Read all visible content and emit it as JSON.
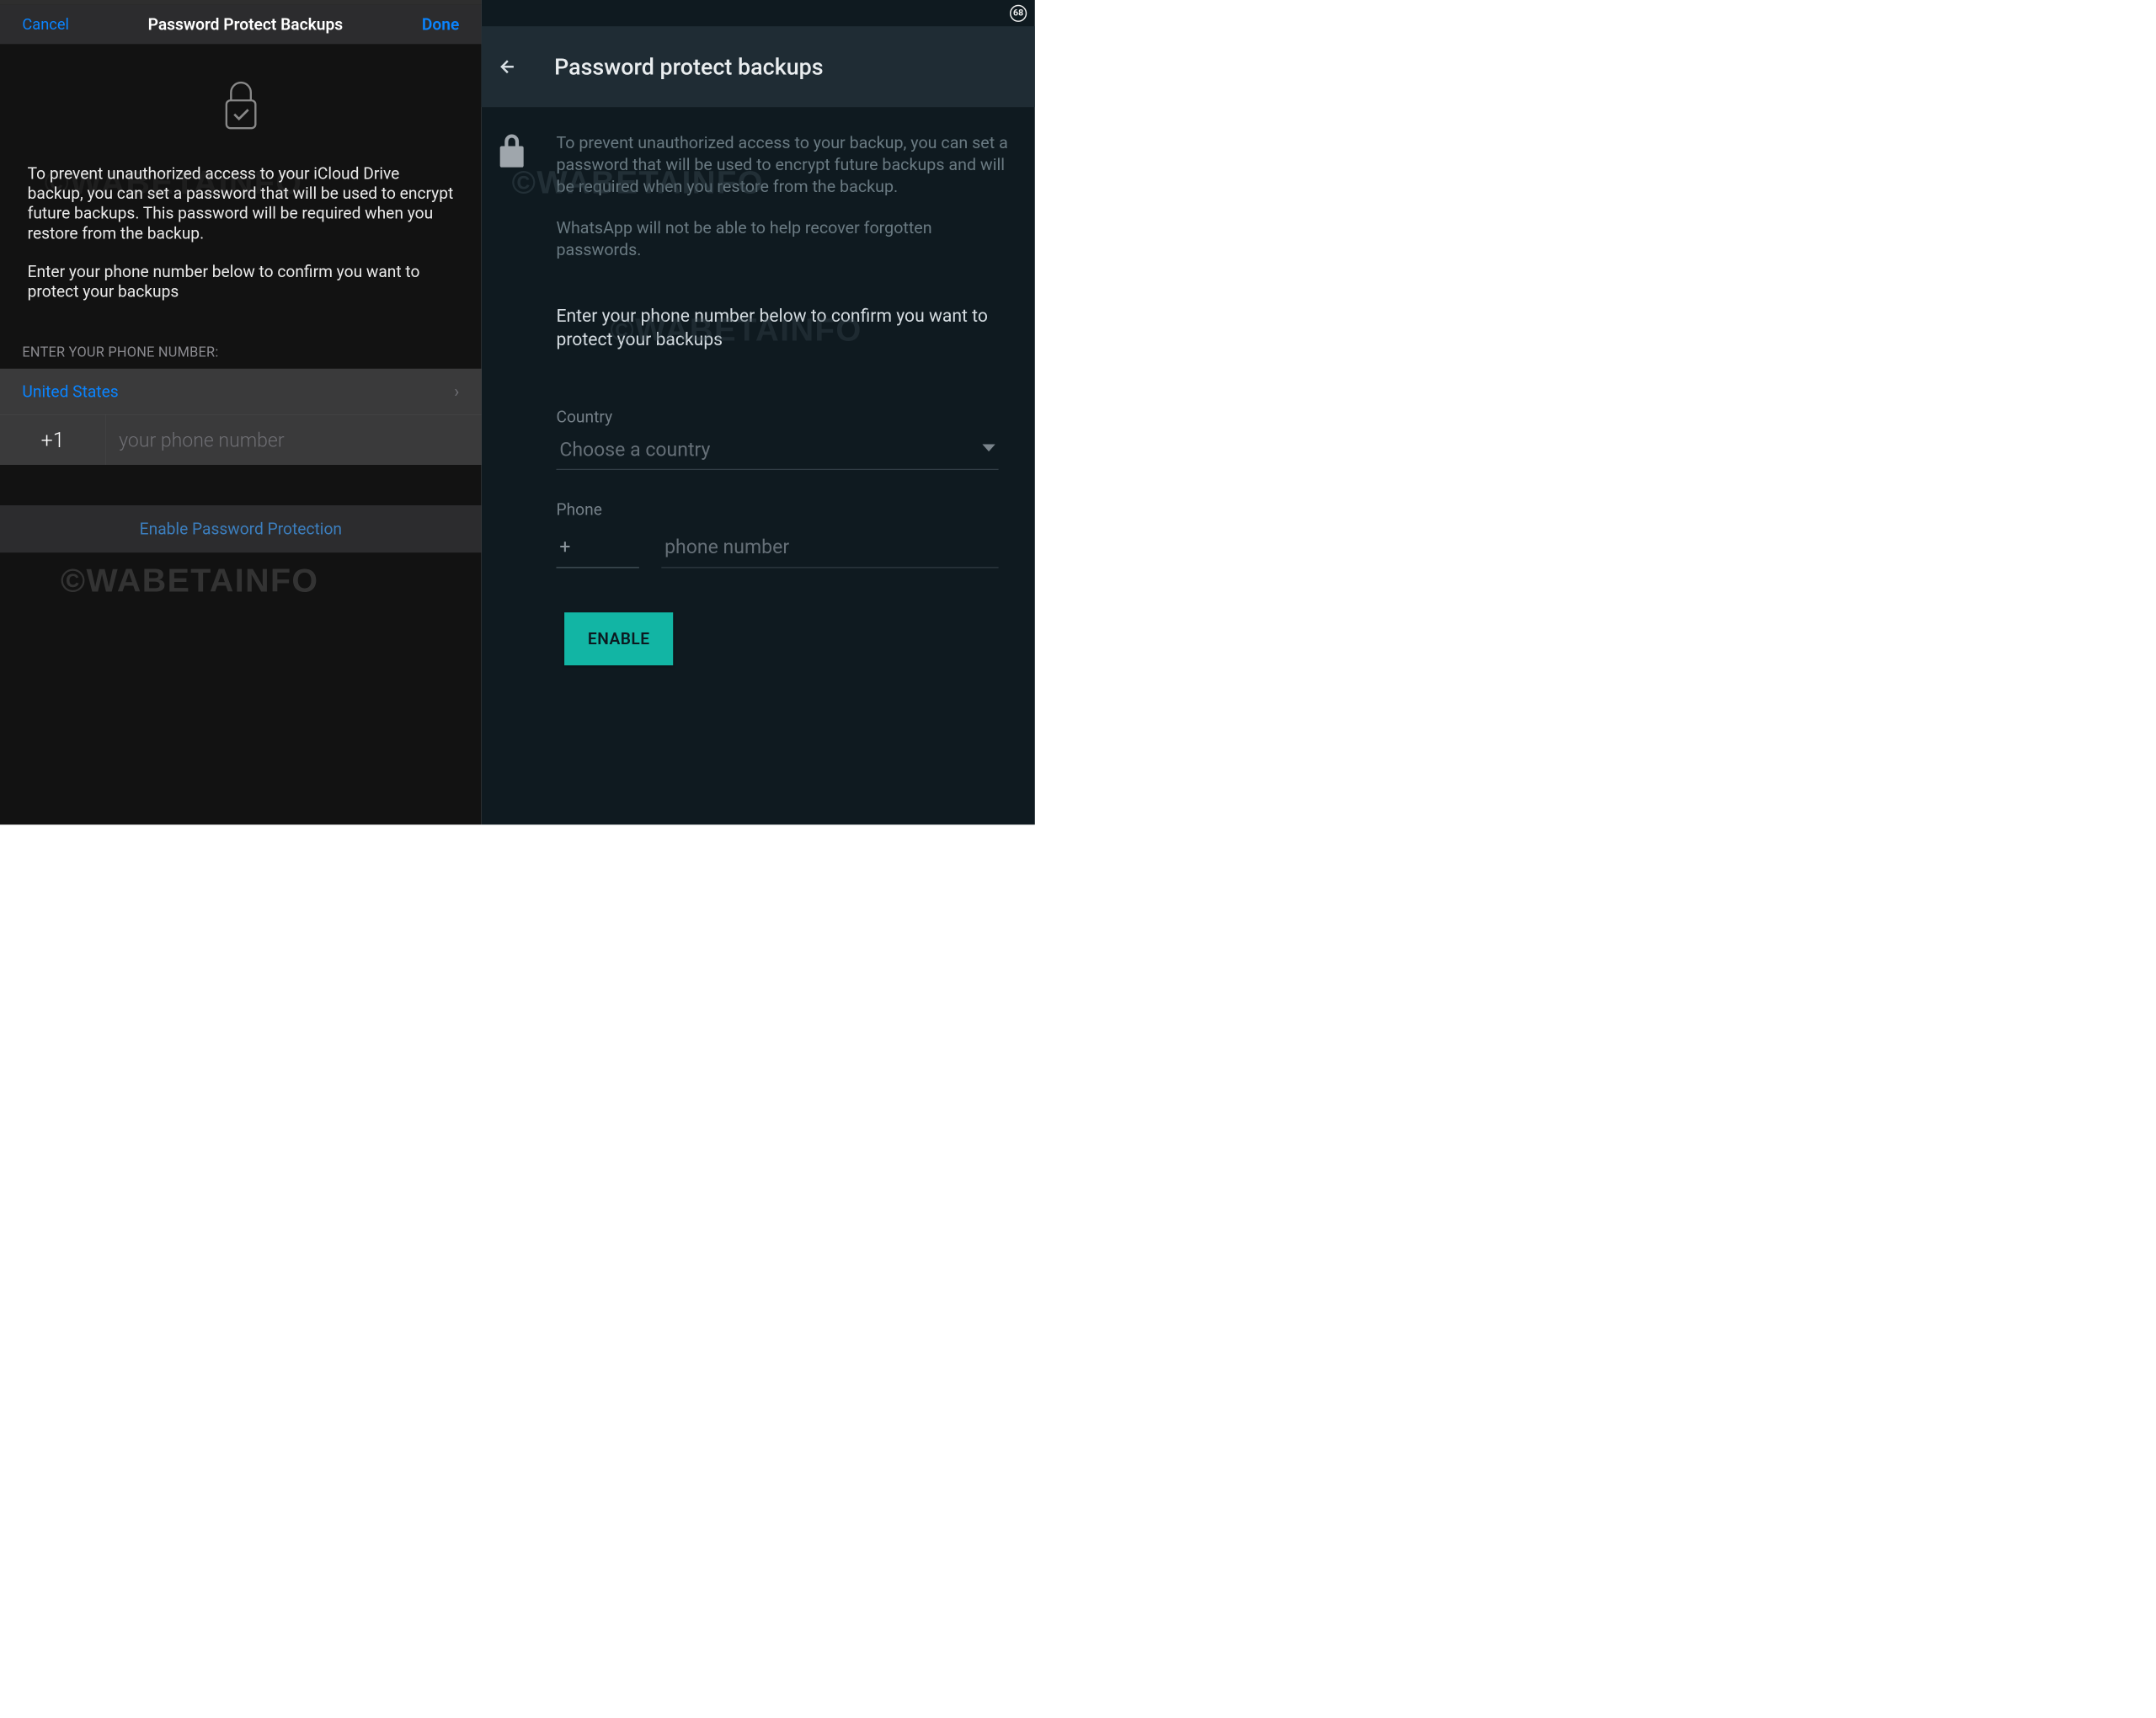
{
  "watermark": "©WABETAINFO",
  "ios": {
    "header": {
      "cancel": "Cancel",
      "title": "Password Protect Backups",
      "done": "Done"
    },
    "body": {
      "description": "To prevent unauthorized access to your iCloud Drive backup, you can set a password that will be used to encrypt future backups. This password will be required when you restore from the backup.",
      "instruction": "Enter your phone number below to confirm you want to protect your backups"
    },
    "section_label": "ENTER YOUR PHONE NUMBER:",
    "country": {
      "name": "United States",
      "code": "+1"
    },
    "phone_placeholder": "your phone number",
    "enable_label": "Enable Password Protection"
  },
  "android": {
    "status_badge": "68",
    "header": {
      "title": "Password protect backups"
    },
    "body": {
      "description": "To prevent unauthorized access to your backup, you can set a password that will be used to encrypt future backups and will be required when you restore from the backup.",
      "warning": "WhatsApp will not be able to help recover forgotten passwords.",
      "instruction": "Enter your phone number below to confirm you want to protect your backups"
    },
    "form": {
      "country_label": "Country",
      "country_placeholder": "Choose a country",
      "phone_label": "Phone",
      "prefix_placeholder": "+",
      "phone_placeholder": "phone number",
      "enable_button": "ENABLE"
    }
  }
}
